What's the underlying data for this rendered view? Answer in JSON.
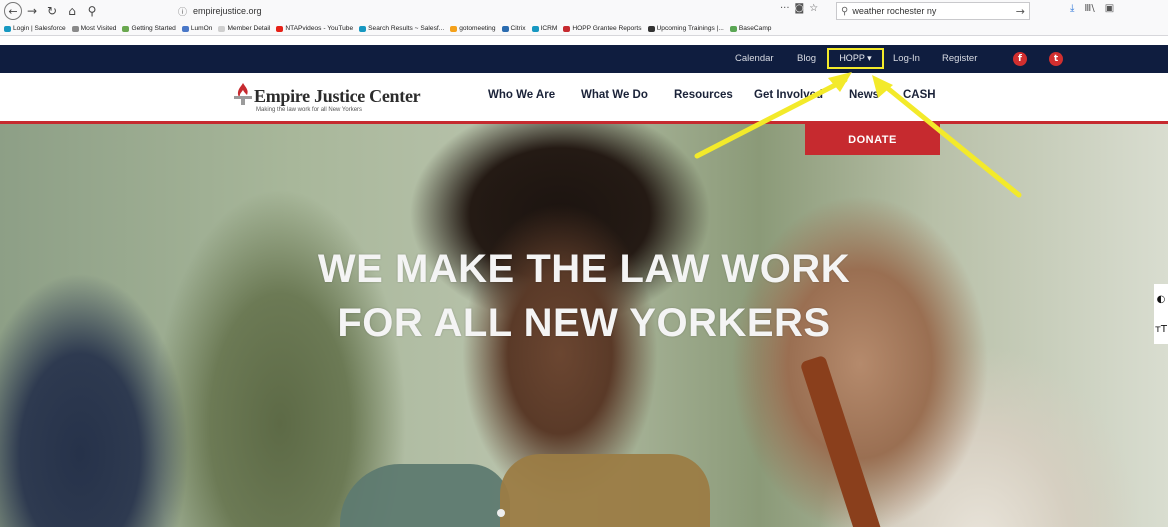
{
  "browser": {
    "url": "empirejustice.org",
    "search_value": "weather rochester ny",
    "icons": [
      "back-icon",
      "forward-icon",
      "reload-icon",
      "home-icon",
      "search-icon",
      "info-icon",
      "more-icon",
      "pocket-icon",
      "star-icon",
      "go-arrow-icon",
      "download-icon",
      "library-icon",
      "sidebar-icon"
    ],
    "bookmarks": [
      "Login | Salesforce",
      "Most Visited",
      "Getting Started",
      "LumOn",
      "Member Detail",
      "NTAPvideos - YouTube",
      "Search Results ~ Salesf...",
      "gotomeeting",
      "Citrix",
      "ICRM",
      "HOPP Grantee Reports",
      "Upcoming Trainings |...",
      "BaseCamp"
    ]
  },
  "topbar": {
    "links": [
      "Calendar",
      "Blog",
      "HOPP",
      "Log-In",
      "Register"
    ],
    "hopp_label": "HOPP ▾",
    "facebook": "f",
    "twitter": "t"
  },
  "header": {
    "logo_name": "Empire Justice Center",
    "logo_tagline": "Making the law work for all New Yorkers",
    "nav": [
      "Who We Are",
      "What We Do",
      "Resources",
      "Get Involved",
      "News",
      "CASH"
    ]
  },
  "hero": {
    "line1": "WE MAKE THE LAW WORK",
    "line2": "FOR ALL NEW YORKERS",
    "donate": "DONATE"
  },
  "a11y": {
    "contrast_icon": "◐",
    "text_size_icon": "ᴛT"
  },
  "colors": {
    "navy": "#0f1d3f",
    "brand_red": "#c62a2f",
    "annotation_yellow": "#f3ea2a"
  }
}
